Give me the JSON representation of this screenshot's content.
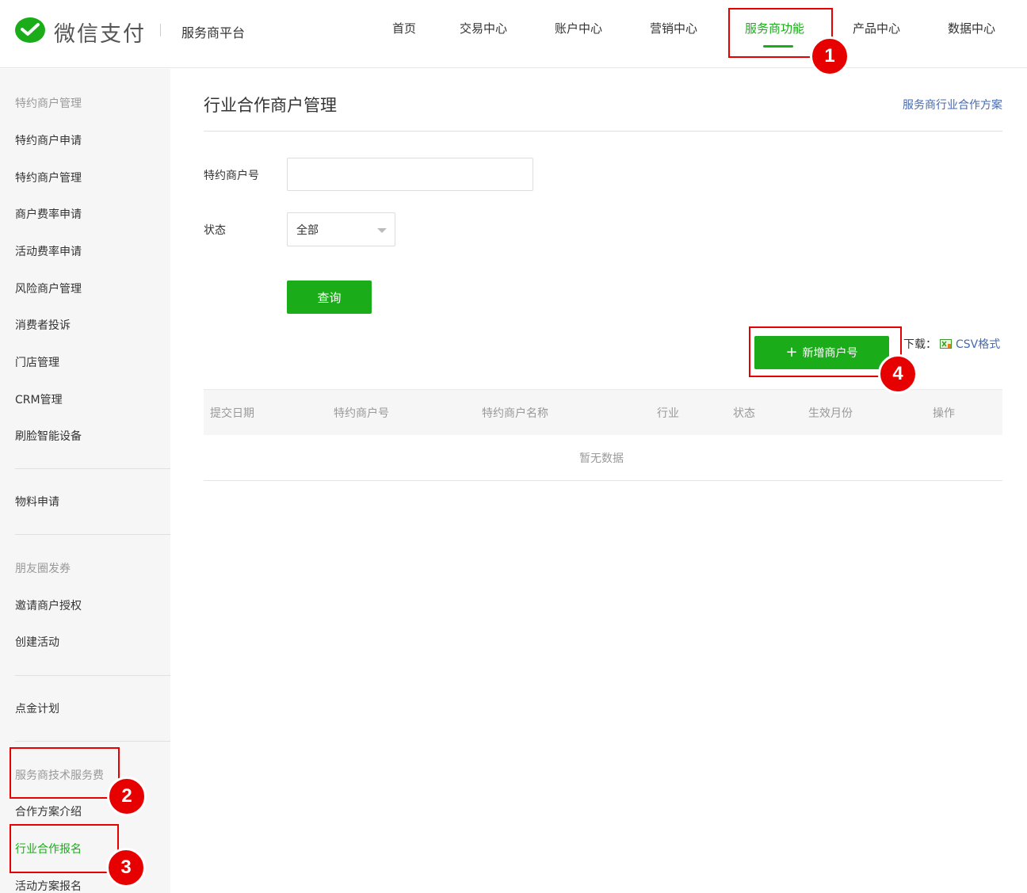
{
  "header": {
    "brand": "微信支付",
    "platform": "服务商平台",
    "nav": [
      "首页",
      "交易中心",
      "账户中心",
      "营销中心",
      "服务商功能",
      "产品中心",
      "数据中心"
    ],
    "active_nav": "服务商功能"
  },
  "sidebar": {
    "items": [
      {
        "label": "特约商户管理",
        "type": "group"
      },
      {
        "label": "特约商户申请",
        "type": "link"
      },
      {
        "label": "特约商户管理",
        "type": "link"
      },
      {
        "label": "商户费率申请",
        "type": "link"
      },
      {
        "label": "活动费率申请",
        "type": "link"
      },
      {
        "label": "风险商户管理",
        "type": "link"
      },
      {
        "label": "消费者投诉",
        "type": "link"
      },
      {
        "label": "门店管理",
        "type": "link"
      },
      {
        "label": "CRM管理",
        "type": "link"
      },
      {
        "label": "刷脸智能设备",
        "type": "link"
      },
      {
        "label": "物料申请",
        "type": "link"
      },
      {
        "label": "朋友圈发券",
        "type": "group"
      },
      {
        "label": "邀请商户授权",
        "type": "link"
      },
      {
        "label": "创建活动",
        "type": "link"
      },
      {
        "label": "点金计划",
        "type": "link"
      },
      {
        "label": "服务商技术服务费",
        "type": "group"
      },
      {
        "label": "合作方案介绍",
        "type": "link"
      },
      {
        "label": "行业合作报名",
        "type": "link",
        "active": true
      },
      {
        "label": "活动方案报名",
        "type": "link"
      }
    ]
  },
  "main": {
    "title": "行业合作商户管理",
    "top_link": "服务商行业合作方案",
    "filters": {
      "merchant_no_label": "特约商户号",
      "merchant_no_value": "",
      "status_label": "状态",
      "status_value": "全部"
    },
    "query_button": "查询",
    "add_button": "新增商户号",
    "download_label": "下载：",
    "download_link": "CSV格式",
    "table": {
      "columns": [
        "提交日期",
        "特约商户号",
        "特约商户名称",
        "行业",
        "状态",
        "生效月份",
        "操作"
      ],
      "rows": [],
      "empty_text": "暂无数据"
    }
  },
  "annotations": [
    "1",
    "2",
    "3",
    "4"
  ],
  "colors": {
    "brand_green": "#1aad19",
    "link_blue": "#466ab0",
    "annotation_red": "#e60000"
  }
}
